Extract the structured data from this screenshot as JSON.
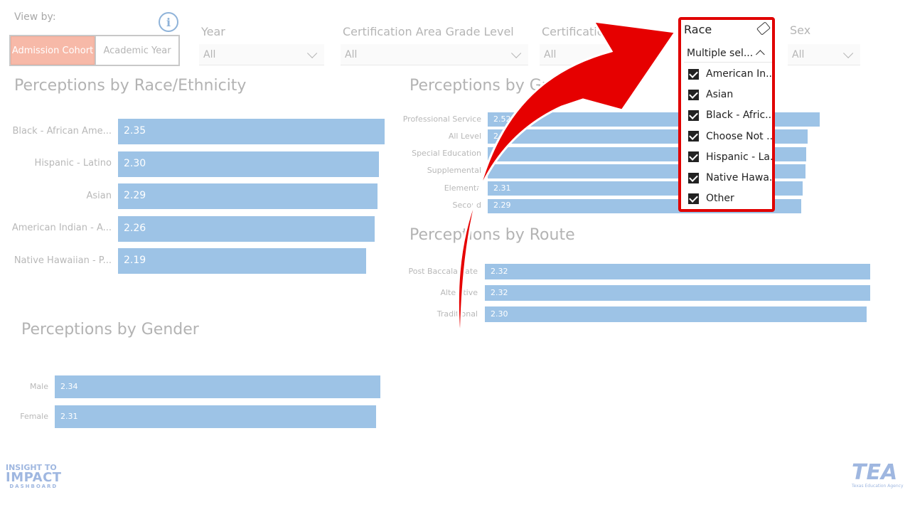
{
  "view_by": {
    "label": "View by:",
    "options": [
      "Admission Cohort",
      "Academic Year"
    ],
    "selected": "Admission Cohort",
    "info_icon": "info-icon"
  },
  "filters": [
    {
      "label": "Year",
      "value": "All"
    },
    {
      "label": "Certification Area Grade Level",
      "value": "All"
    },
    {
      "label": "Certificatio",
      "value": "All"
    },
    {
      "label": "Sex",
      "value": "All"
    }
  ],
  "race_slicer": {
    "title": "Race",
    "selected_text": "Multiple sel...",
    "items": [
      "American In...",
      "Asian",
      "Black - Afric...",
      "Choose Not ...",
      "Hispanic - La...",
      "Native Hawa...",
      "Other"
    ]
  },
  "sections": {
    "race": "Perceptions by Race/Ethnicity",
    "grade": "Perceptions by Gra",
    "route": "Perceptions by Route",
    "gender": "Perceptions by Gender"
  },
  "chart_data": [
    {
      "type": "bar",
      "title": "Perceptions by Race/Ethnicity",
      "categories": [
        "Black - African Ame...",
        "Hispanic - Latino",
        "Asian",
        "American Indian - A...",
        "Native Hawaiian - P..."
      ],
      "values": [
        2.35,
        2.3,
        2.29,
        2.26,
        2.19
      ],
      "value_labels": [
        "2.35",
        "2.30",
        "2.29",
        "2.26",
        "2.19"
      ]
    },
    {
      "type": "bar",
      "title": "Perceptions by Gra",
      "categories": [
        "Professional Service",
        "All Level",
        "Special Education",
        "Supplemental",
        "Elementa",
        "Second"
      ],
      "values": [
        2.52,
        2.43,
        2.42,
        2.41,
        2.39,
        2.38
      ],
      "value_labels": [
        "2.52",
        "2.",
        "",
        "",
        "2.31",
        "2.29"
      ]
    },
    {
      "type": "bar",
      "title": "Perceptions by Route",
      "categories": [
        "Post Baccala    eate",
        "Alte     ative",
        "Traditional"
      ],
      "values": [
        2.32,
        2.32,
        2.3
      ],
      "value_labels": [
        "2.32",
        "2.32",
        "2.30"
      ]
    },
    {
      "type": "bar",
      "title": "Perceptions by Gender",
      "categories": [
        "Male",
        "Female"
      ],
      "values": [
        2.34,
        2.31
      ],
      "value_labels": [
        "2.34",
        "2.31"
      ]
    }
  ],
  "logos": {
    "left_line1": "INSIGHT TO",
    "left_line2": "IMPACT",
    "left_line3": "DASHBOARD",
    "right_name": "TEA",
    "right_sub": "Texas Education Agency"
  },
  "colors": {
    "bar": "#9dc3e6",
    "highlight": "#e00000",
    "active_toggle": "#f7b9a8"
  }
}
